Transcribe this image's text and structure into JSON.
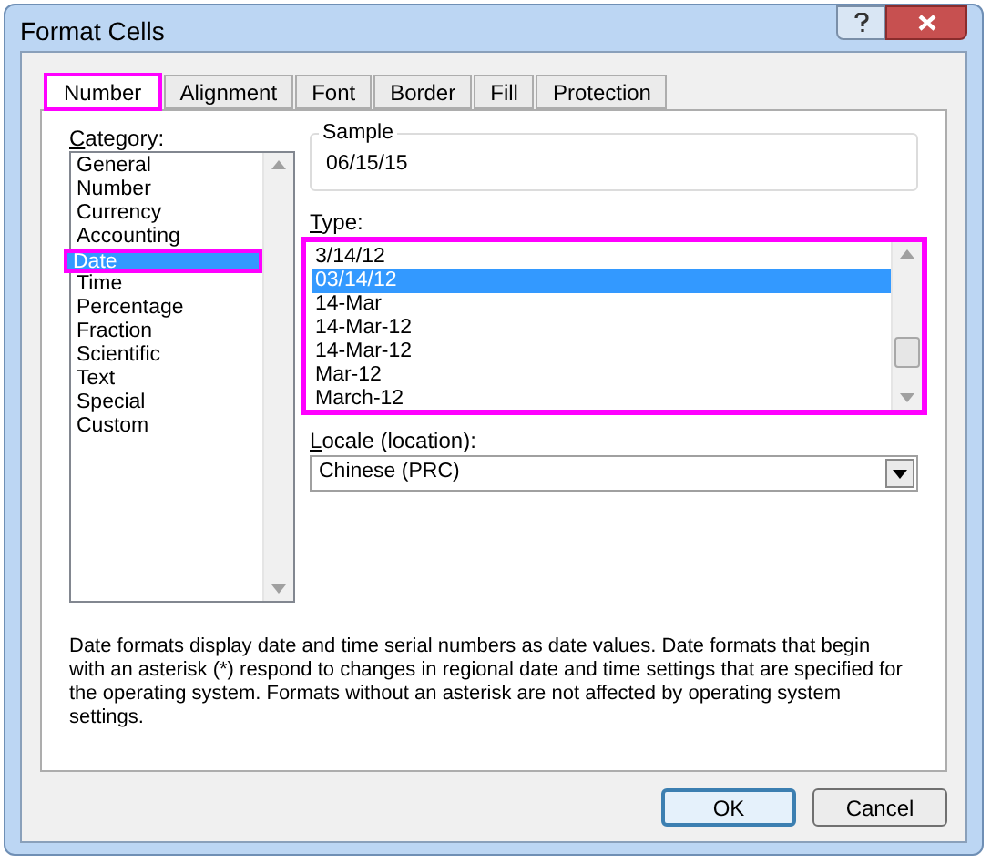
{
  "window": {
    "title": "Format Cells"
  },
  "tabs": [
    {
      "label": "Number",
      "selected": true
    },
    {
      "label": "Alignment",
      "selected": false
    },
    {
      "label": "Font",
      "selected": false
    },
    {
      "label": "Border",
      "selected": false
    },
    {
      "label": "Fill",
      "selected": false
    },
    {
      "label": "Protection",
      "selected": false
    }
  ],
  "category": {
    "label": "Category:",
    "items": [
      {
        "label": "General",
        "selected": false
      },
      {
        "label": "Number",
        "selected": false
      },
      {
        "label": "Currency",
        "selected": false
      },
      {
        "label": "Accounting",
        "selected": false
      },
      {
        "label": "Date",
        "selected": true
      },
      {
        "label": "Time",
        "selected": false
      },
      {
        "label": "Percentage",
        "selected": false
      },
      {
        "label": "Fraction",
        "selected": false
      },
      {
        "label": "Scientific",
        "selected": false
      },
      {
        "label": "Text",
        "selected": false
      },
      {
        "label": "Special",
        "selected": false
      },
      {
        "label": "Custom",
        "selected": false
      }
    ]
  },
  "sample": {
    "label": "Sample",
    "value": "06/15/15"
  },
  "type": {
    "label": "Type:",
    "items": [
      {
        "label": "3/14/12",
        "selected": false
      },
      {
        "label": "03/14/12",
        "selected": true
      },
      {
        "label": "14-Mar",
        "selected": false
      },
      {
        "label": "14-Mar-12",
        "selected": false
      },
      {
        "label": "14-Mar-12",
        "selected": false
      },
      {
        "label": "Mar-12",
        "selected": false
      },
      {
        "label": "March-12",
        "selected": false
      }
    ]
  },
  "locale": {
    "label": "Locale (location):",
    "value": "Chinese (PRC)"
  },
  "description": "Date formats display date and time serial numbers as date values.  Date formats that begin with an asterisk (*) respond to changes in regional date and time settings that are specified for the operating system. Formats without an asterisk are not affected by operating system settings.",
  "buttons": [
    {
      "label": "OK",
      "default": true
    },
    {
      "label": "Cancel",
      "default": false
    }
  ]
}
